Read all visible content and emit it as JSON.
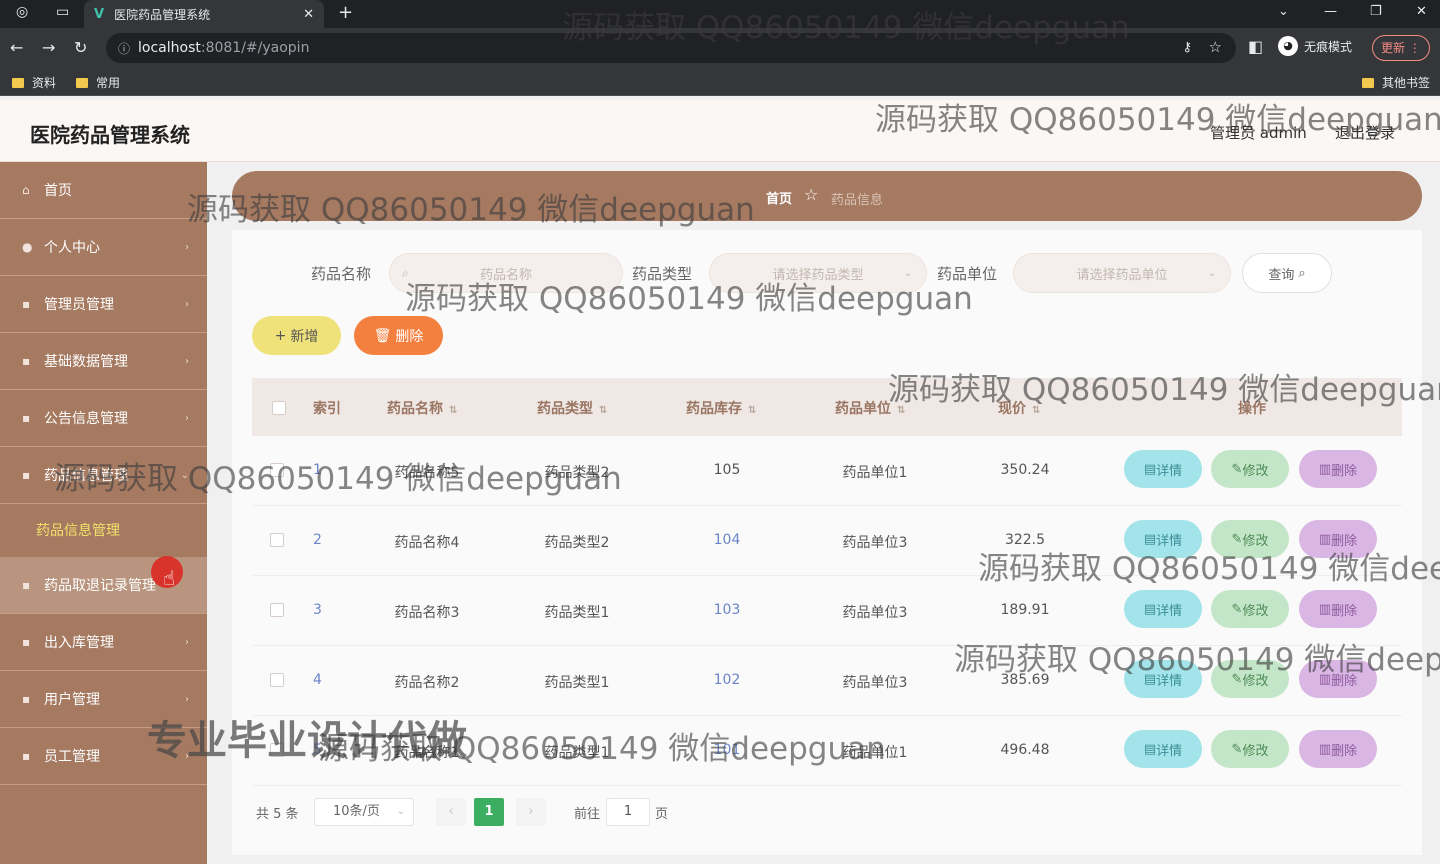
{
  "browser": {
    "tab_title": "医院药品管理系统",
    "tab_favicon": "V",
    "url_host": "localhost",
    "url_rest": ":8081/#/yaopin",
    "incognito_label": "无痕模式",
    "update_label": "更新",
    "bookmarks": [
      "资料",
      "常用"
    ],
    "other_bookmarks": "其他书签"
  },
  "header": {
    "title": "医院药品管理系统",
    "user": "管理员 admin",
    "logout": "退出登录"
  },
  "sidebar": {
    "items": [
      {
        "label": "首页"
      },
      {
        "label": "个人中心"
      },
      {
        "label": "管理员管理"
      },
      {
        "label": "基础数据管理"
      },
      {
        "label": "公告信息管理"
      },
      {
        "label": "药品信息管理"
      },
      {
        "label": "药品取退记录管理"
      },
      {
        "label": "出入库管理"
      },
      {
        "label": "用户管理"
      },
      {
        "label": "员工管理"
      }
    ],
    "sub_item": "药品信息管理"
  },
  "breadcrumb": {
    "home": "首页",
    "current": "药品信息"
  },
  "filters": {
    "name_label": "药品名称",
    "name_placeholder": "药品名称",
    "type_label": "药品类型",
    "type_placeholder": "请选择药品类型",
    "unit_label": "药品单位",
    "unit_placeholder": "请选择药品单位",
    "query_button": "查询"
  },
  "actions": {
    "add": "新增",
    "delete": "删除"
  },
  "table": {
    "columns": [
      "索引",
      "药品名称",
      "药品类型",
      "药品库存",
      "药品单位",
      "现价",
      "操作"
    ],
    "rows": [
      {
        "index": "1",
        "name": "药品名称5",
        "type": "药品类型2",
        "stock": "105",
        "unit": "药品单位1",
        "price": "350.24"
      },
      {
        "index": "2",
        "name": "药品名称4",
        "type": "药品类型2",
        "stock": "104",
        "unit": "药品单位3",
        "price": "322.5"
      },
      {
        "index": "3",
        "name": "药品名称3",
        "type": "药品类型1",
        "stock": "103",
        "unit": "药品单位3",
        "price": "189.91"
      },
      {
        "index": "4",
        "name": "药品名称2",
        "type": "药品类型1",
        "stock": "102",
        "unit": "药品单位3",
        "price": "385.69"
      },
      {
        "index": "5",
        "name": "药品名称1",
        "type": "药品类型1",
        "stock": "101",
        "unit": "药品单位1",
        "price": "496.48"
      }
    ],
    "row_buttons": {
      "detail": "详情",
      "edit": "修改",
      "delete": "删除"
    }
  },
  "pagination": {
    "total": "共 5 条",
    "page_size": "10条/页",
    "current_page": "1",
    "goto_label": "前往",
    "goto_value": "1",
    "goto_unit": "页"
  },
  "watermarks": {
    "contact": "源码获取 QQ86050149 微信deepguan",
    "contact_cut1": "源码获取 QQ86050149 微信deep",
    "contact_cut2": "源码获取 QQ86050149 微信deepgu",
    "slogan": "专业毕业设计代做"
  },
  "colors": {
    "sidebar": "#a57a61",
    "header_bg": "#fbf7f5",
    "add_button": "#f0e27a",
    "delete_button": "#f4803f",
    "detail_button": "#a2e4ea",
    "edit_button": "#c4e6c8",
    "row_delete_button": "#d9b6e4",
    "active_page": "#3cae62"
  },
  "icons": [
    "back-icon",
    "forward-icon",
    "reload-icon",
    "info-icon",
    "key-icon",
    "star-icon",
    "sidebar-icon",
    "menu-dots-icon",
    "search-icon",
    "plus-icon",
    "trash-icon",
    "document-icon",
    "pencil-icon",
    "sort-icon",
    "cursor-icon"
  ]
}
